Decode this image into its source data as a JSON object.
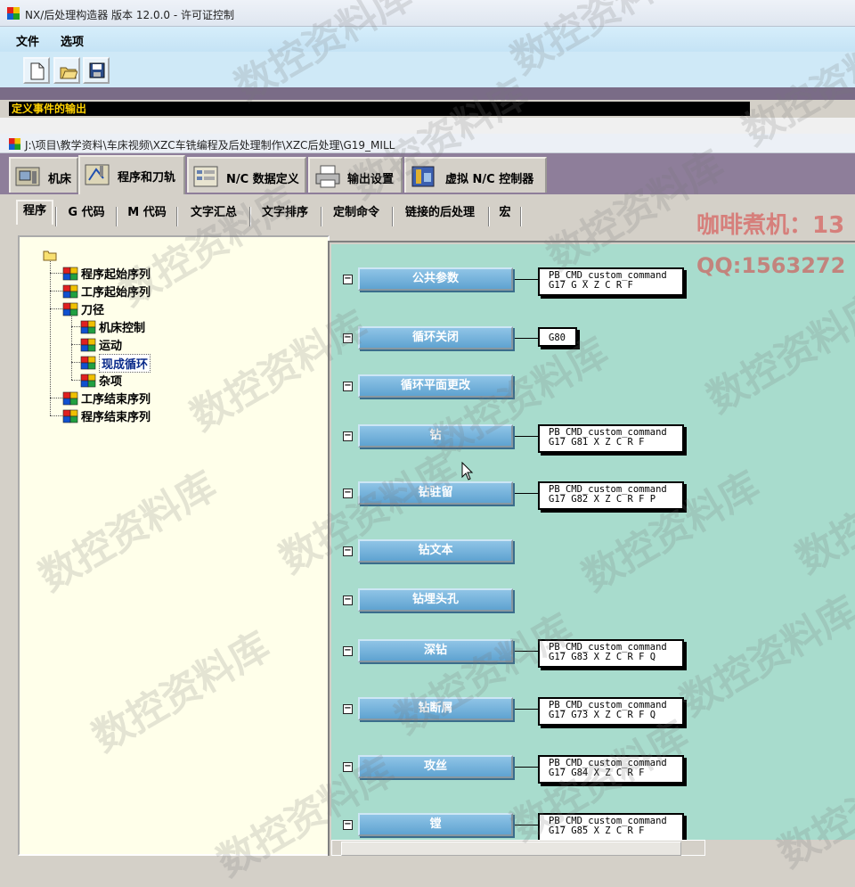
{
  "window": {
    "title": "NX/后处理构造器 版本 12.0.0 - 许可证控制"
  },
  "menu": [
    {
      "label": "文件"
    },
    {
      "label": "选项"
    }
  ],
  "toolbar": [
    {
      "icon": "new-file-icon"
    },
    {
      "icon": "open-folder-icon"
    },
    {
      "icon": "save-icon"
    }
  ],
  "status": {
    "text": "定义事件的输出"
  },
  "document": {
    "path": "J:\\项目\\教学资料\\车床视频\\XZC车铣编程及后处理制作\\XZC后处理\\G19_MILL"
  },
  "tabs": [
    {
      "label": "机床",
      "icon": "machine-icon"
    },
    {
      "label": "程序和刀轨",
      "icon": "program-toolpath-icon",
      "active": true
    },
    {
      "label": "N/C 数据定义",
      "icon": "nc-data-icon"
    },
    {
      "label": "输出设置",
      "icon": "printer-icon"
    },
    {
      "label": "虚拟 N/C 控制器",
      "icon": "virtual-controller-icon"
    }
  ],
  "subtabs": [
    {
      "label": "程序",
      "active": true
    },
    {
      "label": "G 代码"
    },
    {
      "label": "M 代码"
    },
    {
      "label": "文字汇总"
    },
    {
      "label": "文字排序"
    },
    {
      "label": "定制命令"
    },
    {
      "label": "链接的后处理"
    },
    {
      "label": "宏"
    }
  ],
  "tree": [
    {
      "label": "程序起始序列",
      "level": 1
    },
    {
      "label": "工序起始序列",
      "level": 1
    },
    {
      "label": "刀径",
      "level": 1
    },
    {
      "label": "机床控制",
      "level": 2
    },
    {
      "label": "运动",
      "level": 2
    },
    {
      "label": "现成循环",
      "level": 2,
      "selected": true
    },
    {
      "label": "杂项",
      "level": 2
    },
    {
      "label": "工序结束序列",
      "level": 1
    },
    {
      "label": "程序结束序列",
      "level": 1
    }
  ],
  "events": [
    {
      "label": "公共参数",
      "cmd": [
        "PB_CMD_custom_command",
        "G17 G X Z C R F"
      ]
    },
    {
      "label": "循环关闭",
      "cmd": [
        "G80"
      ]
    },
    {
      "label": "循环平面更改",
      "cmd": []
    },
    {
      "label": "钻",
      "cmd": [
        "PB_CMD_custom_command",
        "G17 G81 X Z C R F"
      ]
    },
    {
      "label": "钻驻留",
      "cmd": [
        "PB_CMD_custom_command",
        "G17 G82 X Z C R F P"
      ]
    },
    {
      "label": "钻文本",
      "cmd": []
    },
    {
      "label": "钻埋头孔",
      "cmd": []
    },
    {
      "label": "深钻",
      "cmd": [
        "PB_CMD_custom_command",
        "G17 G83 X Z C R F Q"
      ]
    },
    {
      "label": "钻断屑",
      "cmd": [
        "PB_CMD_custom_command",
        "G17 G73 X Z C R F Q"
      ]
    },
    {
      "label": "攻丝",
      "cmd": [
        "PB_CMD_custom_command",
        "G17 G84 X Z C R F"
      ]
    },
    {
      "label": "镗",
      "cmd": [
        "PB_CMD_custom_command",
        "G17 G85 X Z C R F"
      ]
    }
  ],
  "overlay": {
    "ad_line1": "咖啡煮机：13",
    "ad_line2": "QQ:1563272",
    "watermark": "数控资料库"
  },
  "colors": {
    "canvas": "#a8dccd",
    "tree_bg": "#ffffea",
    "event_button": "#6aa9d6",
    "status_text": "#ffd200"
  }
}
